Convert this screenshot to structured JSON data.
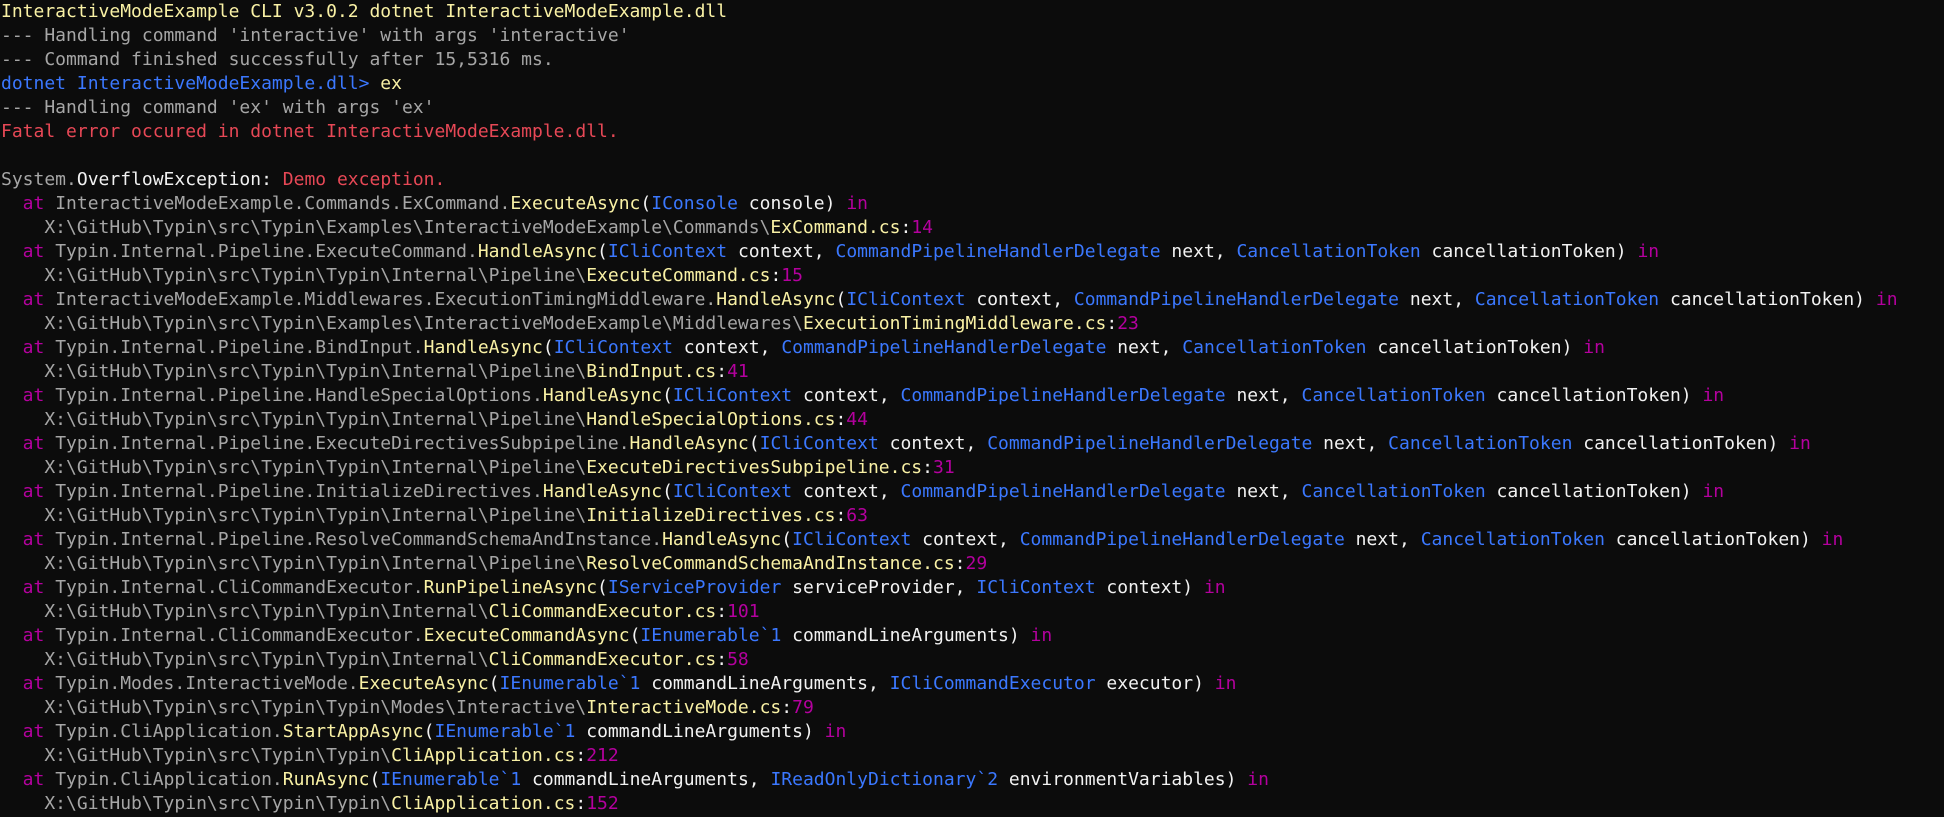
{
  "terminal": {
    "background": "#0c0c0c",
    "colors": {
      "default": "#cccccc",
      "dim": "#a6a6a6",
      "highlight": "#f9f1a5",
      "type": "#3b78ff",
      "error": "#e74856",
      "keyword": "#b4009e",
      "file": "#f9f1a5"
    },
    "lines": [
      [
        {
          "t": "InteractiveModeExample CLI v3.0.2 dotnet InteractiveModeExample.dll",
          "c": "c-yellow"
        }
      ],
      [
        {
          "t": "--- Handling command 'interactive' with args 'interactive'",
          "c": "c-dim"
        }
      ],
      [
        {
          "t": "--- Command finished successfully after 15,5316 ms.",
          "c": "c-dim"
        }
      ],
      [
        {
          "t": "dotnet InteractiveModeExample.dll> ",
          "c": "c-blue"
        },
        {
          "t": "ex",
          "c": "c-yellow"
        }
      ],
      [
        {
          "t": "--- Handling command 'ex' with args 'ex'",
          "c": "c-dim"
        }
      ],
      [
        {
          "t": "Fatal error occured in dotnet InteractiveModeExample.dll.",
          "c": "c-red"
        }
      ],
      [
        {
          "t": "",
          "c": "c-gray"
        }
      ],
      [
        {
          "t": "System.",
          "c": "c-dim"
        },
        {
          "t": "OverflowException",
          "c": "c-white"
        },
        {
          "t": ": ",
          "c": "c-white"
        },
        {
          "t": "Demo exception.",
          "c": "c-red"
        }
      ],
      [
        {
          "t": "  at ",
          "c": "c-magenta"
        },
        {
          "t": "InteractiveModeExample.Commands.ExCommand.",
          "c": "c-dim"
        },
        {
          "t": "ExecuteAsync",
          "c": "c-yellow"
        },
        {
          "t": "(",
          "c": "c-white"
        },
        {
          "t": "IConsole",
          "c": "c-blue"
        },
        {
          "t": " console) ",
          "c": "c-white"
        },
        {
          "t": "in",
          "c": "c-magenta"
        }
      ],
      [
        {
          "t": "    X:\\GitHub\\Typin\\src\\Typin\\Examples\\InteractiveModeExample\\Commands\\",
          "c": "c-dim"
        },
        {
          "t": "ExCommand.cs",
          "c": "c-yellow"
        },
        {
          "t": ":",
          "c": "c-white"
        },
        {
          "t": "14",
          "c": "c-magenta"
        }
      ],
      [
        {
          "t": "  at ",
          "c": "c-magenta"
        },
        {
          "t": "Typin.Internal.Pipeline.ExecuteCommand.",
          "c": "c-dim"
        },
        {
          "t": "HandleAsync",
          "c": "c-yellow"
        },
        {
          "t": "(",
          "c": "c-white"
        },
        {
          "t": "ICliContext",
          "c": "c-blue"
        },
        {
          "t": " context, ",
          "c": "c-white"
        },
        {
          "t": "CommandPipelineHandlerDelegate",
          "c": "c-blue"
        },
        {
          "t": " next, ",
          "c": "c-white"
        },
        {
          "t": "CancellationToken",
          "c": "c-blue"
        },
        {
          "t": " cancellationToken) ",
          "c": "c-white"
        },
        {
          "t": "in",
          "c": "c-magenta"
        }
      ],
      [
        {
          "t": "    X:\\GitHub\\Typin\\src\\Typin\\Typin\\Internal\\Pipeline\\",
          "c": "c-dim"
        },
        {
          "t": "ExecuteCommand.cs",
          "c": "c-yellow"
        },
        {
          "t": ":",
          "c": "c-white"
        },
        {
          "t": "15",
          "c": "c-magenta"
        }
      ],
      [
        {
          "t": "  at ",
          "c": "c-magenta"
        },
        {
          "t": "InteractiveModeExample.Middlewares.ExecutionTimingMiddleware.",
          "c": "c-dim"
        },
        {
          "t": "HandleAsync",
          "c": "c-yellow"
        },
        {
          "t": "(",
          "c": "c-white"
        },
        {
          "t": "ICliContext",
          "c": "c-blue"
        },
        {
          "t": " context, ",
          "c": "c-white"
        },
        {
          "t": "CommandPipelineHandlerDelegate",
          "c": "c-blue"
        },
        {
          "t": " next, ",
          "c": "c-white"
        },
        {
          "t": "CancellationToken",
          "c": "c-blue"
        },
        {
          "t": " cancellationToken) ",
          "c": "c-white"
        },
        {
          "t": "in",
          "c": "c-magenta"
        }
      ],
      [
        {
          "t": "    X:\\GitHub\\Typin\\src\\Typin\\Examples\\InteractiveModeExample\\Middlewares\\",
          "c": "c-dim"
        },
        {
          "t": "ExecutionTimingMiddleware.cs",
          "c": "c-yellow"
        },
        {
          "t": ":",
          "c": "c-white"
        },
        {
          "t": "23",
          "c": "c-magenta"
        }
      ],
      [
        {
          "t": "  at ",
          "c": "c-magenta"
        },
        {
          "t": "Typin.Internal.Pipeline.BindInput.",
          "c": "c-dim"
        },
        {
          "t": "HandleAsync",
          "c": "c-yellow"
        },
        {
          "t": "(",
          "c": "c-white"
        },
        {
          "t": "ICliContext",
          "c": "c-blue"
        },
        {
          "t": " context, ",
          "c": "c-white"
        },
        {
          "t": "CommandPipelineHandlerDelegate",
          "c": "c-blue"
        },
        {
          "t": " next, ",
          "c": "c-white"
        },
        {
          "t": "CancellationToken",
          "c": "c-blue"
        },
        {
          "t": " cancellationToken) ",
          "c": "c-white"
        },
        {
          "t": "in",
          "c": "c-magenta"
        }
      ],
      [
        {
          "t": "    X:\\GitHub\\Typin\\src\\Typin\\Typin\\Internal\\Pipeline\\",
          "c": "c-dim"
        },
        {
          "t": "BindInput.cs",
          "c": "c-yellow"
        },
        {
          "t": ":",
          "c": "c-white"
        },
        {
          "t": "41",
          "c": "c-magenta"
        }
      ],
      [
        {
          "t": "  at ",
          "c": "c-magenta"
        },
        {
          "t": "Typin.Internal.Pipeline.HandleSpecialOptions.",
          "c": "c-dim"
        },
        {
          "t": "HandleAsync",
          "c": "c-yellow"
        },
        {
          "t": "(",
          "c": "c-white"
        },
        {
          "t": "ICliContext",
          "c": "c-blue"
        },
        {
          "t": " context, ",
          "c": "c-white"
        },
        {
          "t": "CommandPipelineHandlerDelegate",
          "c": "c-blue"
        },
        {
          "t": " next, ",
          "c": "c-white"
        },
        {
          "t": "CancellationToken",
          "c": "c-blue"
        },
        {
          "t": " cancellationToken) ",
          "c": "c-white"
        },
        {
          "t": "in",
          "c": "c-magenta"
        }
      ],
      [
        {
          "t": "    X:\\GitHub\\Typin\\src\\Typin\\Typin\\Internal\\Pipeline\\",
          "c": "c-dim"
        },
        {
          "t": "HandleSpecialOptions.cs",
          "c": "c-yellow"
        },
        {
          "t": ":",
          "c": "c-white"
        },
        {
          "t": "44",
          "c": "c-magenta"
        }
      ],
      [
        {
          "t": "  at ",
          "c": "c-magenta"
        },
        {
          "t": "Typin.Internal.Pipeline.ExecuteDirectivesSubpipeline.",
          "c": "c-dim"
        },
        {
          "t": "HandleAsync",
          "c": "c-yellow"
        },
        {
          "t": "(",
          "c": "c-white"
        },
        {
          "t": "ICliContext",
          "c": "c-blue"
        },
        {
          "t": " context, ",
          "c": "c-white"
        },
        {
          "t": "CommandPipelineHandlerDelegate",
          "c": "c-blue"
        },
        {
          "t": " next, ",
          "c": "c-white"
        },
        {
          "t": "CancellationToken",
          "c": "c-blue"
        },
        {
          "t": " cancellationToken) ",
          "c": "c-white"
        },
        {
          "t": "in",
          "c": "c-magenta"
        }
      ],
      [
        {
          "t": "    X:\\GitHub\\Typin\\src\\Typin\\Typin\\Internal\\Pipeline\\",
          "c": "c-dim"
        },
        {
          "t": "ExecuteDirectivesSubpipeline.cs",
          "c": "c-yellow"
        },
        {
          "t": ":",
          "c": "c-white"
        },
        {
          "t": "31",
          "c": "c-magenta"
        }
      ],
      [
        {
          "t": "  at ",
          "c": "c-magenta"
        },
        {
          "t": "Typin.Internal.Pipeline.InitializeDirectives.",
          "c": "c-dim"
        },
        {
          "t": "HandleAsync",
          "c": "c-yellow"
        },
        {
          "t": "(",
          "c": "c-white"
        },
        {
          "t": "ICliContext",
          "c": "c-blue"
        },
        {
          "t": " context, ",
          "c": "c-white"
        },
        {
          "t": "CommandPipelineHandlerDelegate",
          "c": "c-blue"
        },
        {
          "t": " next, ",
          "c": "c-white"
        },
        {
          "t": "CancellationToken",
          "c": "c-blue"
        },
        {
          "t": " cancellationToken) ",
          "c": "c-white"
        },
        {
          "t": "in",
          "c": "c-magenta"
        }
      ],
      [
        {
          "t": "    X:\\GitHub\\Typin\\src\\Typin\\Typin\\Internal\\Pipeline\\",
          "c": "c-dim"
        },
        {
          "t": "InitializeDirectives.cs",
          "c": "c-yellow"
        },
        {
          "t": ":",
          "c": "c-white"
        },
        {
          "t": "63",
          "c": "c-magenta"
        }
      ],
      [
        {
          "t": "  at ",
          "c": "c-magenta"
        },
        {
          "t": "Typin.Internal.Pipeline.ResolveCommandSchemaAndInstance.",
          "c": "c-dim"
        },
        {
          "t": "HandleAsync",
          "c": "c-yellow"
        },
        {
          "t": "(",
          "c": "c-white"
        },
        {
          "t": "ICliContext",
          "c": "c-blue"
        },
        {
          "t": " context, ",
          "c": "c-white"
        },
        {
          "t": "CommandPipelineHandlerDelegate",
          "c": "c-blue"
        },
        {
          "t": " next, ",
          "c": "c-white"
        },
        {
          "t": "CancellationToken",
          "c": "c-blue"
        },
        {
          "t": " cancellationToken) ",
          "c": "c-white"
        },
        {
          "t": "in",
          "c": "c-magenta"
        }
      ],
      [
        {
          "t": "    X:\\GitHub\\Typin\\src\\Typin\\Typin\\Internal\\Pipeline\\",
          "c": "c-dim"
        },
        {
          "t": "ResolveCommandSchemaAndInstance.cs",
          "c": "c-yellow"
        },
        {
          "t": ":",
          "c": "c-white"
        },
        {
          "t": "29",
          "c": "c-magenta"
        }
      ],
      [
        {
          "t": "  at ",
          "c": "c-magenta"
        },
        {
          "t": "Typin.Internal.CliCommandExecutor.",
          "c": "c-dim"
        },
        {
          "t": "RunPipelineAsync",
          "c": "c-yellow"
        },
        {
          "t": "(",
          "c": "c-white"
        },
        {
          "t": "IServiceProvider",
          "c": "c-blue"
        },
        {
          "t": " serviceProvider, ",
          "c": "c-white"
        },
        {
          "t": "ICliContext",
          "c": "c-blue"
        },
        {
          "t": " context) ",
          "c": "c-white"
        },
        {
          "t": "in",
          "c": "c-magenta"
        }
      ],
      [
        {
          "t": "    X:\\GitHub\\Typin\\src\\Typin\\Typin\\Internal\\",
          "c": "c-dim"
        },
        {
          "t": "CliCommandExecutor.cs",
          "c": "c-yellow"
        },
        {
          "t": ":",
          "c": "c-white"
        },
        {
          "t": "101",
          "c": "c-magenta"
        }
      ],
      [
        {
          "t": "  at ",
          "c": "c-magenta"
        },
        {
          "t": "Typin.Internal.CliCommandExecutor.",
          "c": "c-dim"
        },
        {
          "t": "ExecuteCommandAsync",
          "c": "c-yellow"
        },
        {
          "t": "(",
          "c": "c-white"
        },
        {
          "t": "IEnumerable`1",
          "c": "c-blue"
        },
        {
          "t": " commandLineArguments) ",
          "c": "c-white"
        },
        {
          "t": "in",
          "c": "c-magenta"
        }
      ],
      [
        {
          "t": "    X:\\GitHub\\Typin\\src\\Typin\\Typin\\Internal\\",
          "c": "c-dim"
        },
        {
          "t": "CliCommandExecutor.cs",
          "c": "c-yellow"
        },
        {
          "t": ":",
          "c": "c-white"
        },
        {
          "t": "58",
          "c": "c-magenta"
        }
      ],
      [
        {
          "t": "  at ",
          "c": "c-magenta"
        },
        {
          "t": "Typin.Modes.InteractiveMode.",
          "c": "c-dim"
        },
        {
          "t": "ExecuteAsync",
          "c": "c-yellow"
        },
        {
          "t": "(",
          "c": "c-white"
        },
        {
          "t": "IEnumerable`1",
          "c": "c-blue"
        },
        {
          "t": " commandLineArguments, ",
          "c": "c-white"
        },
        {
          "t": "ICliCommandExecutor",
          "c": "c-blue"
        },
        {
          "t": " executor) ",
          "c": "c-white"
        },
        {
          "t": "in",
          "c": "c-magenta"
        }
      ],
      [
        {
          "t": "    X:\\GitHub\\Typin\\src\\Typin\\Typin\\Modes\\Interactive\\",
          "c": "c-dim"
        },
        {
          "t": "InteractiveMode.cs",
          "c": "c-yellow"
        },
        {
          "t": ":",
          "c": "c-white"
        },
        {
          "t": "79",
          "c": "c-magenta"
        }
      ],
      [
        {
          "t": "  at ",
          "c": "c-magenta"
        },
        {
          "t": "Typin.CliApplication.",
          "c": "c-dim"
        },
        {
          "t": "StartAppAsync",
          "c": "c-yellow"
        },
        {
          "t": "(",
          "c": "c-white"
        },
        {
          "t": "IEnumerable`1",
          "c": "c-blue"
        },
        {
          "t": " commandLineArguments) ",
          "c": "c-white"
        },
        {
          "t": "in",
          "c": "c-magenta"
        }
      ],
      [
        {
          "t": "    X:\\GitHub\\Typin\\src\\Typin\\Typin\\",
          "c": "c-dim"
        },
        {
          "t": "CliApplication.cs",
          "c": "c-yellow"
        },
        {
          "t": ":",
          "c": "c-white"
        },
        {
          "t": "212",
          "c": "c-magenta"
        }
      ],
      [
        {
          "t": "  at ",
          "c": "c-magenta"
        },
        {
          "t": "Typin.CliApplication.",
          "c": "c-dim"
        },
        {
          "t": "RunAsync",
          "c": "c-yellow"
        },
        {
          "t": "(",
          "c": "c-white"
        },
        {
          "t": "IEnumerable`1",
          "c": "c-blue"
        },
        {
          "t": " commandLineArguments, ",
          "c": "c-white"
        },
        {
          "t": "IReadOnlyDictionary`2",
          "c": "c-blue"
        },
        {
          "t": " environmentVariables) ",
          "c": "c-white"
        },
        {
          "t": "in",
          "c": "c-magenta"
        }
      ],
      [
        {
          "t": "    X:\\GitHub\\Typin\\src\\Typin\\Typin\\",
          "c": "c-dim"
        },
        {
          "t": "CliApplication.cs",
          "c": "c-yellow"
        },
        {
          "t": ":",
          "c": "c-white"
        },
        {
          "t": "152",
          "c": "c-magenta"
        }
      ]
    ]
  }
}
